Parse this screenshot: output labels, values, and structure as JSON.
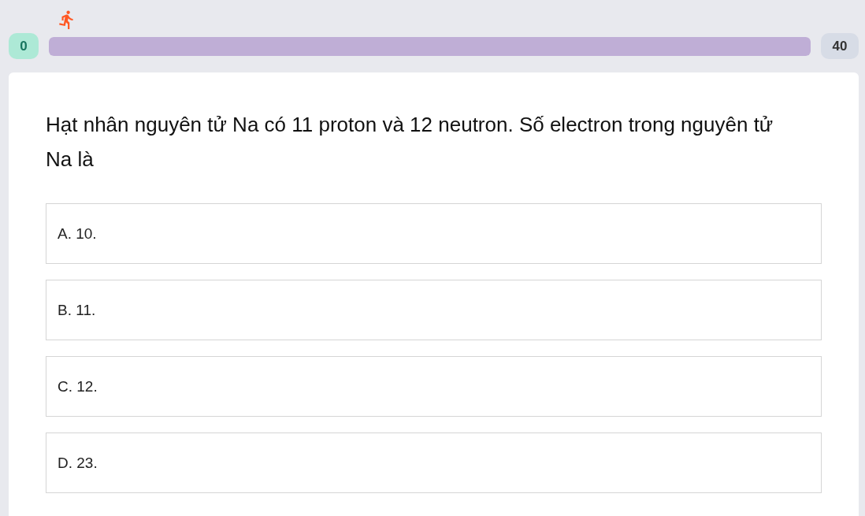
{
  "progress": {
    "start": "0",
    "end": "40",
    "level": 1
  },
  "question": "Hạt nhân nguyên tử Na có 11 proton và 12 neutron. Số electron trong nguyên tử Na là",
  "options": [
    {
      "label": "A. 10.",
      "selected": false
    },
    {
      "label": "B. 11.",
      "selected": false
    },
    {
      "label": "C. 12.",
      "selected": false
    },
    {
      "label": "D. 23.",
      "selected": false
    }
  ]
}
